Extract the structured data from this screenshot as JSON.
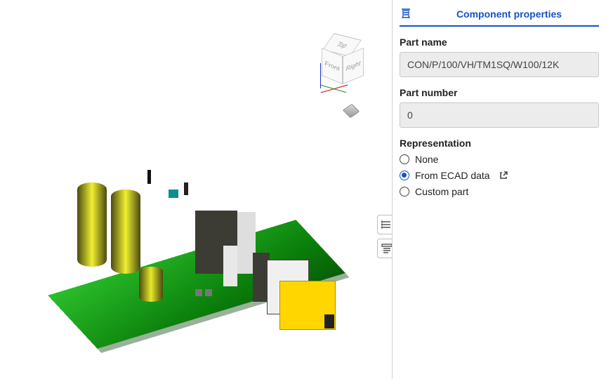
{
  "viewcube": {
    "top": "Top",
    "front": "Front",
    "right": "Right"
  },
  "side_tools": {
    "list_icon": "list-icon",
    "details_icon": "details-icon"
  },
  "panel": {
    "tab_title": "Component properties",
    "part_name_label": "Part name",
    "part_name_value": "CON/P/100/VH/TM1SQ/W100/12K",
    "part_number_label": "Part number",
    "part_number_value": "0",
    "representation_label": "Representation",
    "options": {
      "none": "None",
      "from_ecad": "From ECAD data",
      "custom": "Custom part",
      "selected": "from_ecad"
    }
  }
}
